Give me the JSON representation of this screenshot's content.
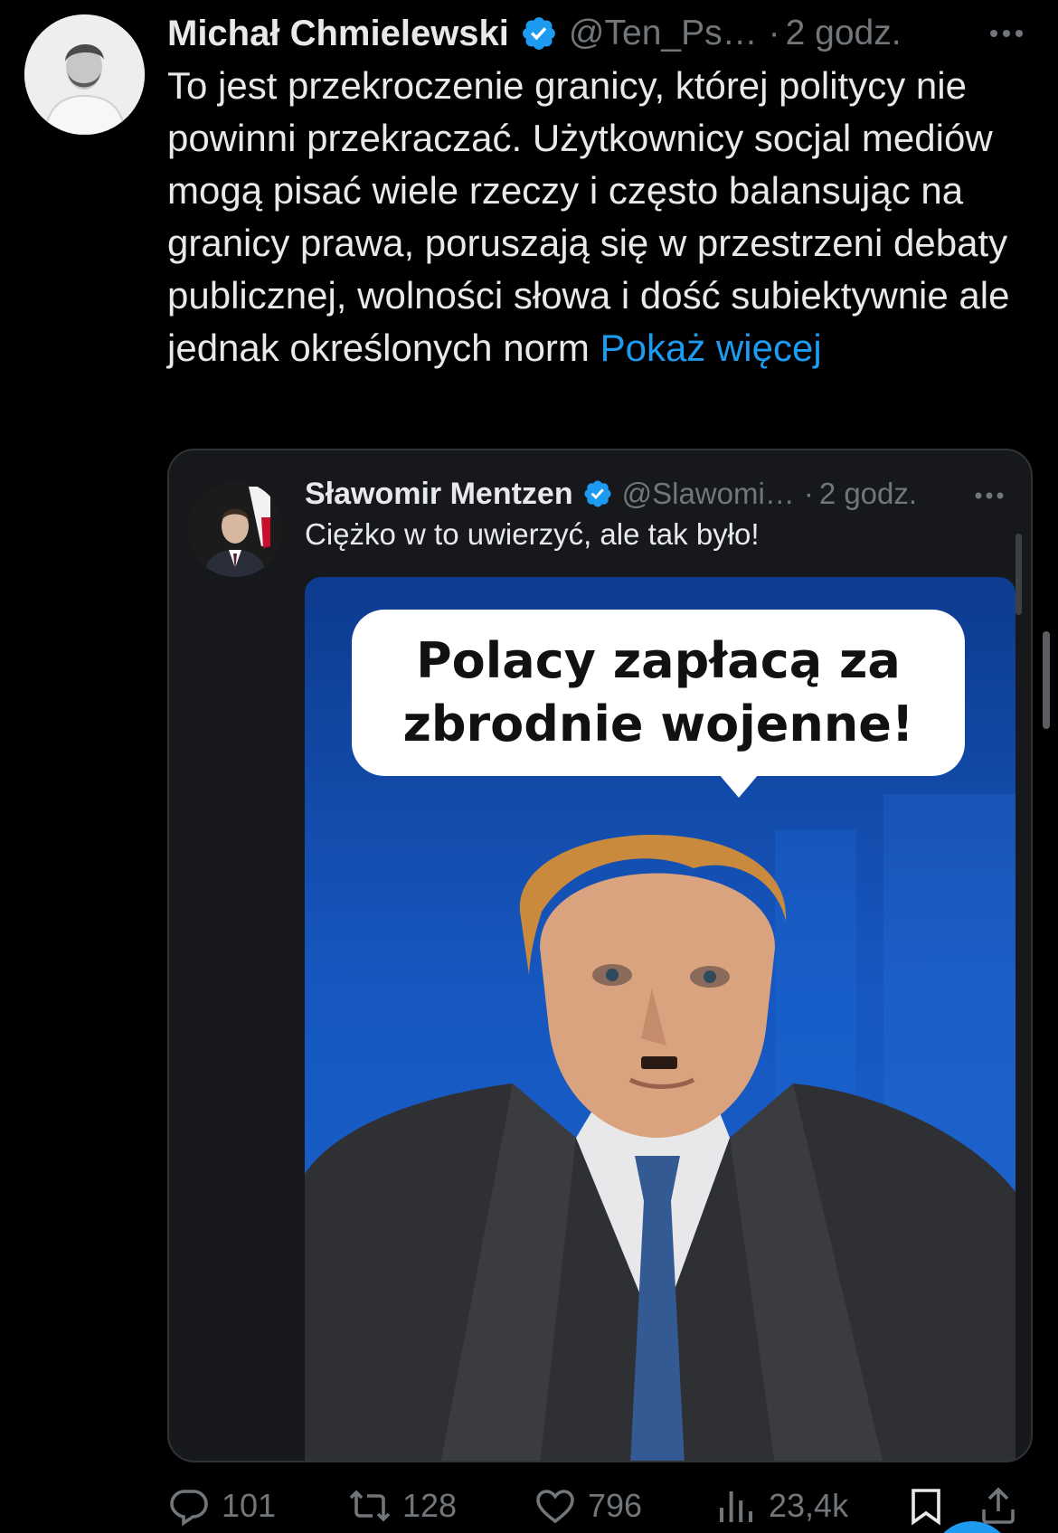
{
  "tweet": {
    "author_name": "Michał Chmielewski",
    "handle": "@Ten_Ps…",
    "separator": "·",
    "time": "2 godz.",
    "text": "To jest przekroczenie granicy, której politycy nie powinni przekraczać. Użytkownicy socjal mediów mogą pisać wiele rzeczy i często balansując na granicy prawa, poruszają się w przestrzeni debaty publicznej, wolności słowa i dość subiektywnie ale jednak określonych norm ",
    "show_more_label": "Pokaż więcej"
  },
  "quoted_tweet": {
    "author_name": "Sławomir Mentzen",
    "handle": "@Slawomi…",
    "separator": "·",
    "time": "2 godz.",
    "text": "Ciężko w to uwierzyć, ale tak było!",
    "image_caption": "Polacy zapłacą za zbrodnie wojenne!"
  },
  "actions": {
    "replies": "101",
    "retweets": "128",
    "likes": "796",
    "views": "23,4k"
  },
  "icons": {
    "verified": "verified-badge-icon",
    "more": "more-options-icon",
    "reply": "reply-icon",
    "retweet": "retweet-icon",
    "like": "heart-icon",
    "views": "views-chart-icon",
    "bookmark": "bookmark-icon",
    "share": "share-icon"
  },
  "colors": {
    "background": "#000000",
    "text_primary": "#e7e9ea",
    "text_secondary": "#71767b",
    "accent": "#1d9bf0",
    "card_border": "#2f3336"
  }
}
